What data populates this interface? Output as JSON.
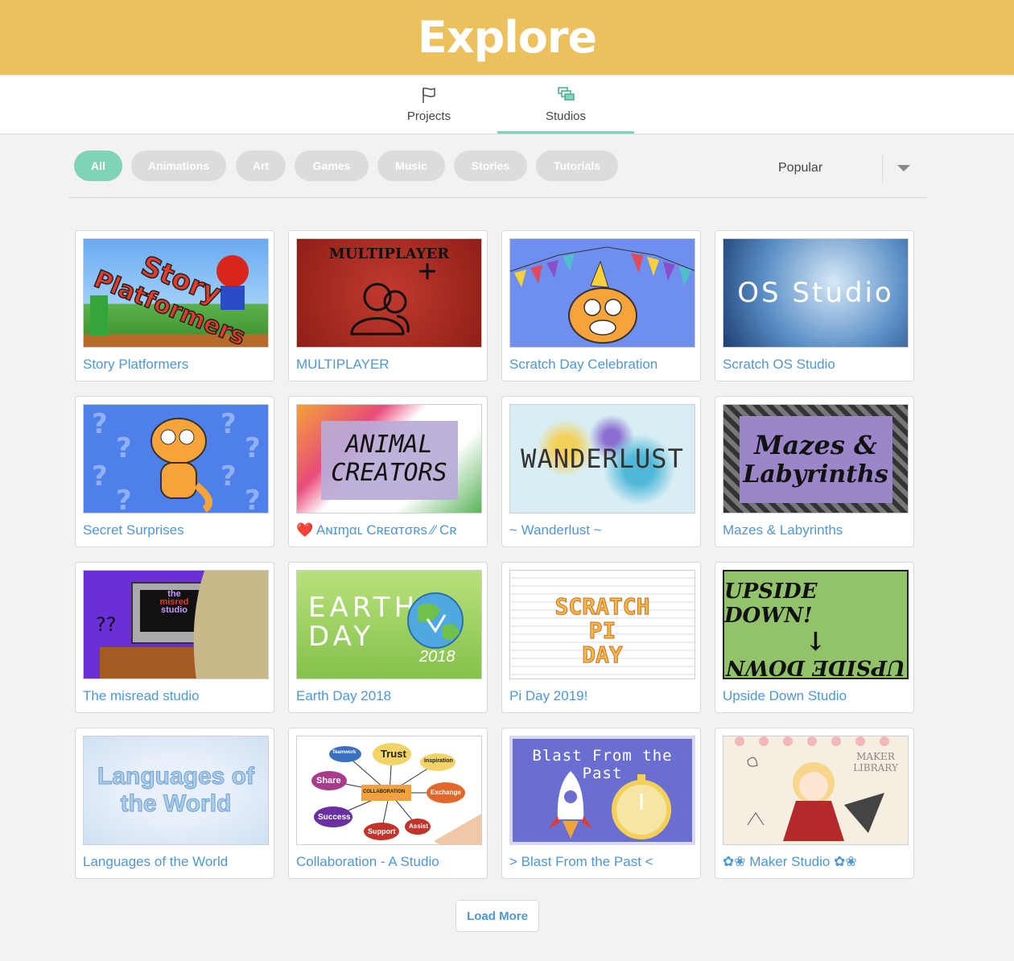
{
  "header": {
    "title": "Explore"
  },
  "tabs": [
    {
      "label": "Projects",
      "icon": "flag-icon",
      "active": false
    },
    {
      "label": "Studios",
      "icon": "studios-icon",
      "active": true
    }
  ],
  "filters": [
    "All",
    "Animations",
    "Art",
    "Games",
    "Music",
    "Stories",
    "Tutorials"
  ],
  "sort": {
    "selected": "Popular"
  },
  "colors": {
    "banner": "#ecc05c",
    "accent": "#7fd4b8",
    "link": "#4d97d6",
    "pill": "#dcdcdc"
  },
  "studios": [
    {
      "title": "Story Platformers",
      "thumb_text": [
        "Story",
        "Platformers"
      ]
    },
    {
      "title": "MULTIPLAYER",
      "thumb_text": [
        "MULTIPLAYER"
      ]
    },
    {
      "title": "Scratch Day Celebration",
      "thumb_text": []
    },
    {
      "title": "Scratch OS Studio",
      "thumb_text": [
        "OS Studio"
      ]
    },
    {
      "title": "Secret Surprises",
      "thumb_text": []
    },
    {
      "title": "❤️ Aɴɪɱαʟ Cʀᴇαтσʀѕ ⁄⁄ Cʀ",
      "thumb_text": [
        "ANIMAL",
        "CREATORS"
      ]
    },
    {
      "title": "~ Wanderlust ~",
      "thumb_text": [
        "WANDERLUST"
      ]
    },
    {
      "title": "Mazes & Labyrinths",
      "thumb_text": [
        "Mazes &",
        "Labyrinths"
      ]
    },
    {
      "title": "The misread studio",
      "thumb_text": [
        "the",
        "misred",
        "studio"
      ]
    },
    {
      "title": "Earth Day 2018",
      "thumb_text": [
        "EARTH",
        "DAY",
        "2018"
      ]
    },
    {
      "title": "Pi Day 2019!",
      "thumb_text": [
        "SCRATCH",
        "PI",
        "DAY"
      ]
    },
    {
      "title": "Upside Down Studio",
      "thumb_text": [
        "UPSIDE DOWN!",
        "↓",
        "UPSIDE DOWN"
      ]
    },
    {
      "title": "Languages of the World",
      "thumb_text": [
        "Languages of",
        "the World"
      ]
    },
    {
      "title": "Collaboration - A Studio",
      "thumb_text": [
        "Trust",
        "Share",
        "COLLABORATION",
        "Exchange",
        "Success",
        "Support",
        "Inspiration",
        "Teamwork",
        "Assist"
      ]
    },
    {
      "title": "> Blast From the Past <",
      "thumb_text": [
        "Blast From the Past"
      ]
    },
    {
      "title": "✿❀ Maker Studio ✿❀",
      "thumb_text": [
        "MAKER",
        "LIBRARY"
      ]
    }
  ],
  "load_more": "Load More"
}
